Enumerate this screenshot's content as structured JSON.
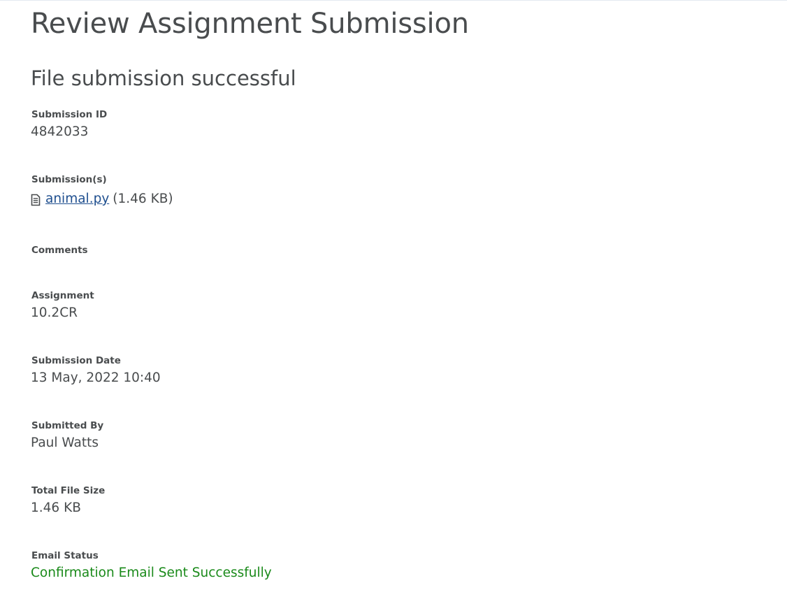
{
  "page": {
    "title": "Review Assignment Submission",
    "status_heading": "File submission successful"
  },
  "fields": {
    "submission_id": {
      "label": "Submission ID",
      "value": "4842033"
    },
    "submissions": {
      "label": "Submission(s)",
      "file_name": "animal.py",
      "file_size": "(1.46 KB)",
      "icon": "file-text-icon"
    },
    "comments": {
      "label": "Comments"
    },
    "assignment": {
      "label": "Assignment",
      "value": "10.2CR"
    },
    "submission_date": {
      "label": "Submission Date",
      "value": "13 May, 2022 10:40"
    },
    "submitted_by": {
      "label": "Submitted By",
      "value": "Paul Watts"
    },
    "total_file_size": {
      "label": "Total File Size",
      "value": "1.46 KB"
    },
    "email_status": {
      "label": "Email Status",
      "value": "Confirmation Email Sent Successfully",
      "color": "#1a8a1a"
    }
  },
  "colors": {
    "text": "#494c4e",
    "link": "#1f4f8f",
    "success": "#1a8a1a"
  }
}
